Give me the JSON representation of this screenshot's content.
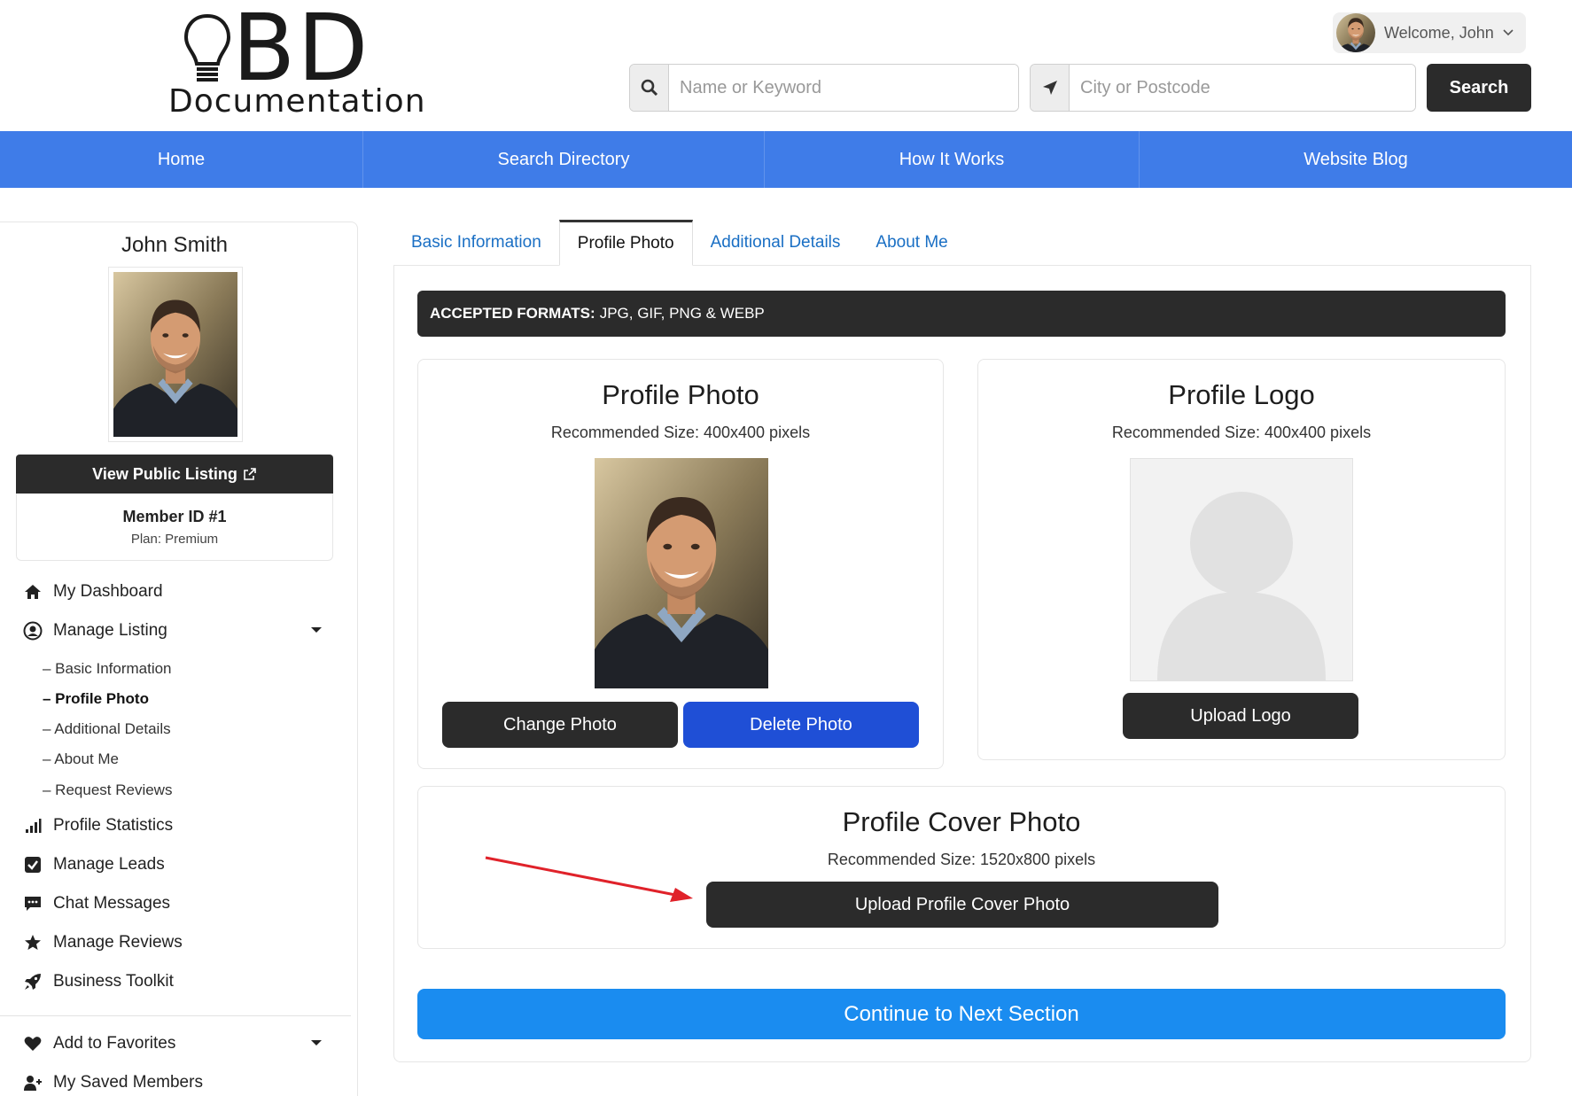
{
  "header": {
    "logo_text": "BD",
    "logo_subtext": "Documentation",
    "welcome_text": "Welcome, John",
    "keyword_placeholder": "Name or Keyword",
    "location_placeholder": "City or Postcode",
    "search_label": "Search"
  },
  "nav": {
    "items": [
      "Home",
      "Search Directory",
      "How It Works",
      "Website Blog"
    ]
  },
  "sidebar": {
    "name": "John Smith",
    "view_public_label": "View Public Listing",
    "member_id": "Member ID #1",
    "plan": "Plan: Premium",
    "menu": {
      "dashboard": "My Dashboard",
      "manage_listing": "Manage Listing",
      "profile_statistics": "Profile Statistics",
      "manage_leads": "Manage Leads",
      "chat_messages": "Chat Messages",
      "manage_reviews": "Manage Reviews",
      "business_toolkit": "Business Toolkit",
      "add_to_favorites": "Add to Favorites",
      "saved_members": "My Saved Members"
    },
    "submenu": [
      "– Basic Information",
      "– Profile Photo",
      "– Additional Details",
      "– About Me",
      "– Request Reviews"
    ]
  },
  "tabs": [
    "Basic Information",
    "Profile Photo",
    "Additional Details",
    "About Me"
  ],
  "active_tab": "Profile Photo",
  "formats": {
    "label": "ACCEPTED FORMATS:",
    "value": "JPG, GIF, PNG & WEBP"
  },
  "profile_photo": {
    "title": "Profile Photo",
    "size": "Recommended Size: 400x400 pixels",
    "change_label": "Change Photo",
    "delete_label": "Delete Photo"
  },
  "profile_logo": {
    "title": "Profile Logo",
    "size": "Recommended Size: 400x400 pixels",
    "upload_label": "Upload Logo"
  },
  "cover_photo": {
    "title": "Profile Cover Photo",
    "size": "Recommended Size: 1520x800 pixels",
    "upload_label": "Upload Profile Cover Photo"
  },
  "continue_label": "Continue to Next Section",
  "colors": {
    "nav_blue": "#3f7ce8",
    "dark": "#2b2b2b",
    "delete_blue": "#1f4fd6",
    "continue_blue": "#1a8cf0",
    "link_blue": "#1a6fc4",
    "arrow_red": "#e0222a"
  }
}
